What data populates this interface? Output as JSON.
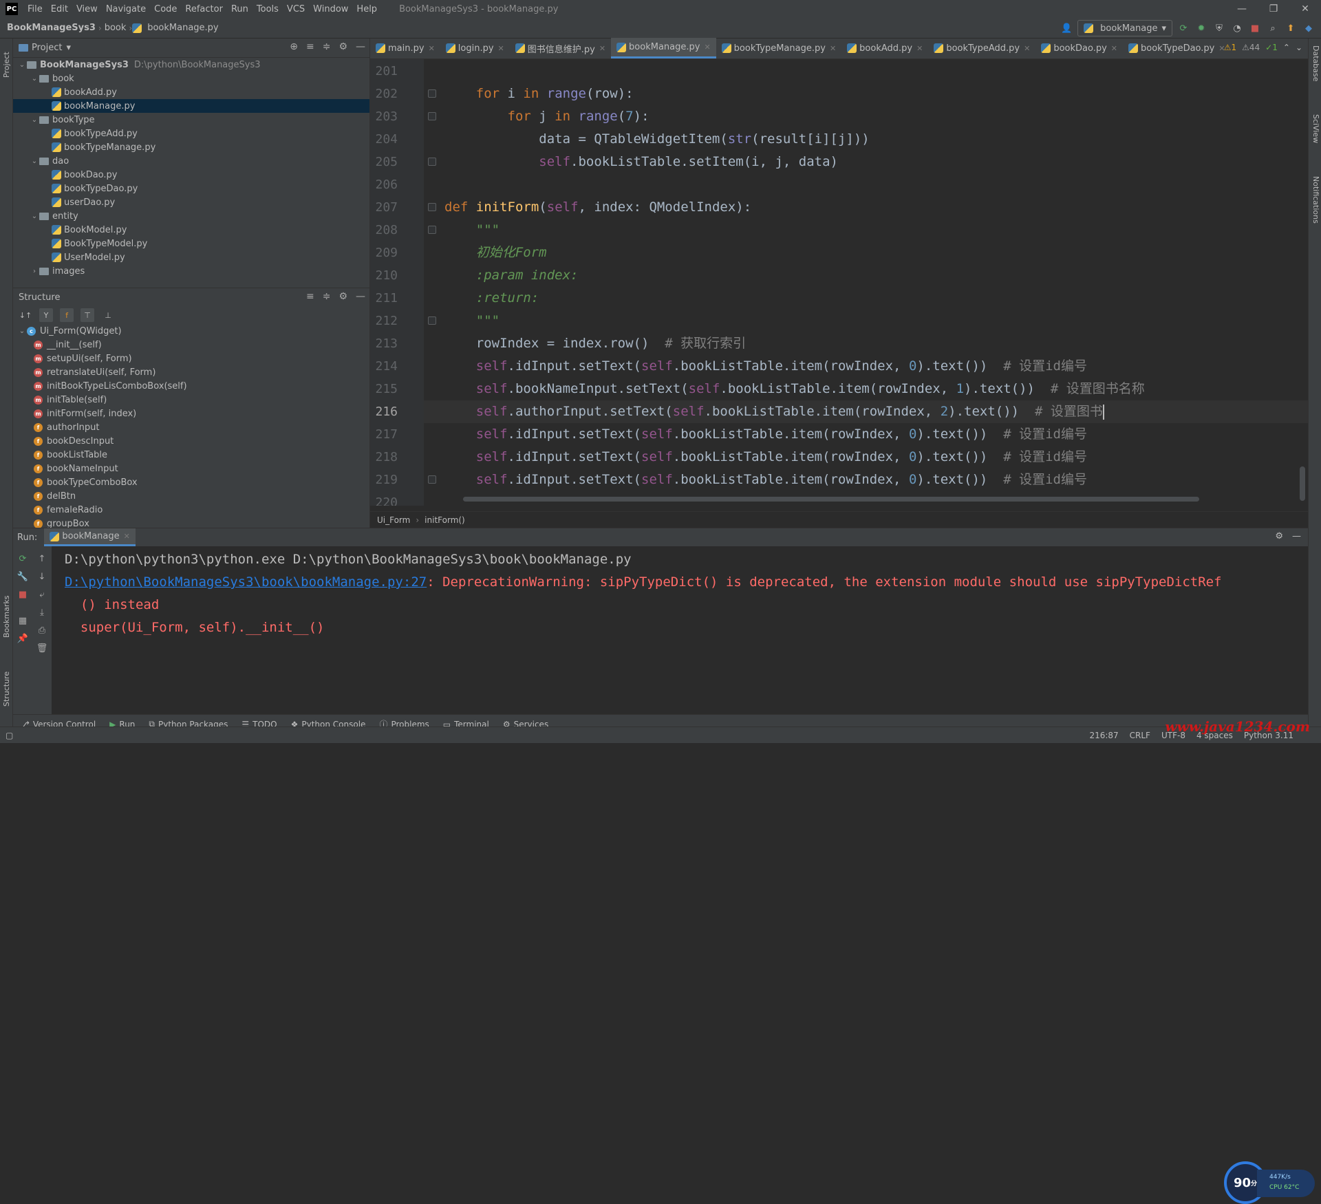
{
  "menubar": {
    "logo": "PC",
    "items": [
      "File",
      "Edit",
      "View",
      "Navigate",
      "Code",
      "Refactor",
      "Run",
      "Tools",
      "VCS",
      "Window",
      "Help"
    ],
    "window_title": "BookManageSys3 - bookManage.py"
  },
  "navbar": {
    "crumbs": [
      "BookManageSys3",
      "book",
      "bookManage.py"
    ],
    "run_config": "bookManage"
  },
  "project": {
    "title": "Project",
    "tree": [
      {
        "label": "BookManageSys3",
        "path": "D:\\python\\BookManageSys3",
        "type": "folder",
        "depth": 0,
        "open": true,
        "bold": true
      },
      {
        "label": "book",
        "type": "folder",
        "depth": 1,
        "open": true
      },
      {
        "label": "bookAdd.py",
        "type": "py",
        "depth": 2
      },
      {
        "label": "bookManage.py",
        "type": "py",
        "depth": 2,
        "selected": true
      },
      {
        "label": "bookType",
        "type": "folder",
        "depth": 1,
        "open": true
      },
      {
        "label": "bookTypeAdd.py",
        "type": "py",
        "depth": 2
      },
      {
        "label": "bookTypeManage.py",
        "type": "py",
        "depth": 2
      },
      {
        "label": "dao",
        "type": "folder",
        "depth": 1,
        "open": true
      },
      {
        "label": "bookDao.py",
        "type": "py",
        "depth": 2
      },
      {
        "label": "bookTypeDao.py",
        "type": "py",
        "depth": 2
      },
      {
        "label": "userDao.py",
        "type": "py",
        "depth": 2
      },
      {
        "label": "entity",
        "type": "folder",
        "depth": 1,
        "open": true
      },
      {
        "label": "BookModel.py",
        "type": "py",
        "depth": 2
      },
      {
        "label": "BookTypeModel.py",
        "type": "py",
        "depth": 2
      },
      {
        "label": "UserModel.py",
        "type": "py",
        "depth": 2
      },
      {
        "label": "images",
        "type": "folder",
        "depth": 1,
        "open": false
      }
    ]
  },
  "structure": {
    "title": "Structure",
    "items": [
      {
        "label": "Ui_Form(QWidget)",
        "kind": "c",
        "depth": 0
      },
      {
        "label": "__init__(self)",
        "kind": "m",
        "depth": 1
      },
      {
        "label": "setupUi(self, Form)",
        "kind": "m",
        "depth": 1
      },
      {
        "label": "retranslateUi(self, Form)",
        "kind": "m",
        "depth": 1
      },
      {
        "label": "initBookTypeLisComboBox(self)",
        "kind": "m",
        "depth": 1
      },
      {
        "label": "initTable(self)",
        "kind": "m",
        "depth": 1
      },
      {
        "label": "initForm(self, index)",
        "kind": "m",
        "depth": 1
      },
      {
        "label": "authorInput",
        "kind": "f",
        "depth": 1
      },
      {
        "label": "bookDescInput",
        "kind": "f",
        "depth": 1
      },
      {
        "label": "bookListTable",
        "kind": "f",
        "depth": 1
      },
      {
        "label": "bookNameInput",
        "kind": "f",
        "depth": 1
      },
      {
        "label": "bookTypeComboBox",
        "kind": "f",
        "depth": 1
      },
      {
        "label": "delBtn",
        "kind": "f",
        "depth": 1
      },
      {
        "label": "femaleRadio",
        "kind": "f",
        "depth": 1
      },
      {
        "label": "groupBox",
        "kind": "f",
        "depth": 1
      }
    ]
  },
  "editor": {
    "tabs": [
      {
        "label": "main.py",
        "active": false
      },
      {
        "label": "login.py",
        "active": false
      },
      {
        "label": "图书信息维护.py",
        "active": false
      },
      {
        "label": "bookManage.py",
        "active": true
      },
      {
        "label": "bookTypeManage.py",
        "active": false
      },
      {
        "label": "bookAdd.py",
        "active": false
      },
      {
        "label": "bookTypeAdd.py",
        "active": false
      },
      {
        "label": "bookDao.py",
        "active": false
      },
      {
        "label": "bookTypeDao.py",
        "active": false
      }
    ],
    "inspections": {
      "warn1": "1",
      "warn2": "44",
      "ok": "1"
    },
    "current_line": 216,
    "lines": [
      {
        "n": 201,
        "html": ""
      },
      {
        "n": 202,
        "html": "    <span class='kw'>for</span> i <span class='kw'>in</span> <span class='bi'>range</span>(row):"
      },
      {
        "n": 203,
        "html": "        <span class='kw'>for</span> j <span class='kw'>in</span> <span class='bi'>range</span>(<span class='num'>7</span>):"
      },
      {
        "n": 204,
        "html": "            data = QTableWidgetItem(<span class='bi'>str</span>(result[i][j]))"
      },
      {
        "n": 205,
        "html": "            <span class='self'>self</span>.bookListTable.setItem(i, j, data)"
      },
      {
        "n": 206,
        "html": ""
      },
      {
        "n": 207,
        "html": "<span class='kw'>def</span> <span class='fn'>initForm</span>(<span class='self'>self</span>, index: QModelIndex):"
      },
      {
        "n": 208,
        "html": "    <span class='doc'>\"\"\"</span>"
      },
      {
        "n": 209,
        "html": "    <span class='doc'>初始化Form</span>"
      },
      {
        "n": 210,
        "html": "    <span class='doc'>:param index:</span>"
      },
      {
        "n": 211,
        "html": "    <span class='doc'>:return:</span>"
      },
      {
        "n": 212,
        "html": "    <span class='doc'>\"\"\"</span>"
      },
      {
        "n": 213,
        "html": "    rowIndex = index.row()  <span class='cm'># 获取行索引</span>"
      },
      {
        "n": 214,
        "html": "    <span class='self'>self</span>.idInput.setText(<span class='self'>self</span>.bookListTable.item(rowIndex, <span class='num'>0</span>).text())  <span class='cm'># 设置id编号</span>"
      },
      {
        "n": 215,
        "html": "    <span class='self'>self</span>.bookNameInput.setText(<span class='self'>self</span>.bookListTable.item(rowIndex, <span class='num'>1</span>).text())  <span class='cm'># 设置图书名称</span>"
      },
      {
        "n": 216,
        "html": "    <span class='self'>self</span>.authorInput.setText(<span class='self'>self</span>.bookListTable.item(rowIndex, <span class='num'>2</span>).text())  <span class='cm'># 设置图书</span><span class='caret'></span>"
      },
      {
        "n": 217,
        "html": "    <span class='self'>self</span>.idInput.setText(<span class='self'>self</span>.bookListTable.item(rowIndex, <span class='num'>0</span>).text())  <span class='cm'># 设置id编号</span>"
      },
      {
        "n": 218,
        "html": "    <span class='self'>self</span>.idInput.setText(<span class='self'>self</span>.bookListTable.item(rowIndex, <span class='num'>0</span>).text())  <span class='cm'># 设置id编号</span>"
      },
      {
        "n": 219,
        "html": "    <span class='self'>self</span>.idInput.setText(<span class='self'>self</span>.bookListTable.item(rowIndex, <span class='num'>0</span>).text())  <span class='cm'># 设置id编号</span>"
      },
      {
        "n": 220,
        "html": ""
      }
    ],
    "breadcrumb": [
      "Ui_Form",
      "initForm()"
    ]
  },
  "run": {
    "label": "Run:",
    "tab": "bookManage",
    "console": [
      {
        "cls": "c-plain",
        "text": "D:\\python\\python3\\python.exe D:\\python\\BookManageSys3\\book\\bookManage.py"
      },
      {
        "parts": [
          {
            "cls": "c-link",
            "text": "D:\\python\\BookManageSys3\\book\\bookManage.py:27"
          },
          {
            "cls": "c-err",
            "text": ": DeprecationWarning: sipPyTypeDict() is deprecated, the extension module should use sipPyTypeDictRef"
          }
        ]
      },
      {
        "cls": "c-err",
        "text": "  () instead"
      },
      {
        "cls": "c-err",
        "text": "  super(Ui_Form, self).__init__()"
      }
    ]
  },
  "widget": {
    "score": "90",
    "unit": "分",
    "net": "447K/s",
    "cpu": "CPU 62°C"
  },
  "bottom_tabs": [
    "Version Control",
    "Run",
    "Python Packages",
    "TODO",
    "Python Console",
    "Problems",
    "Terminal",
    "Services"
  ],
  "status": {
    "position": "216:87",
    "line_sep": "CRLF",
    "encoding": "UTF-8",
    "indent": "4 spaces",
    "interpreter": "Python 3.11"
  },
  "left_strip": [
    "Project",
    "Bookmarks",
    "Structure"
  ],
  "right_strip": [
    "Database",
    "SciView",
    "Notifications"
  ],
  "watermark": "www.java1234.com"
}
